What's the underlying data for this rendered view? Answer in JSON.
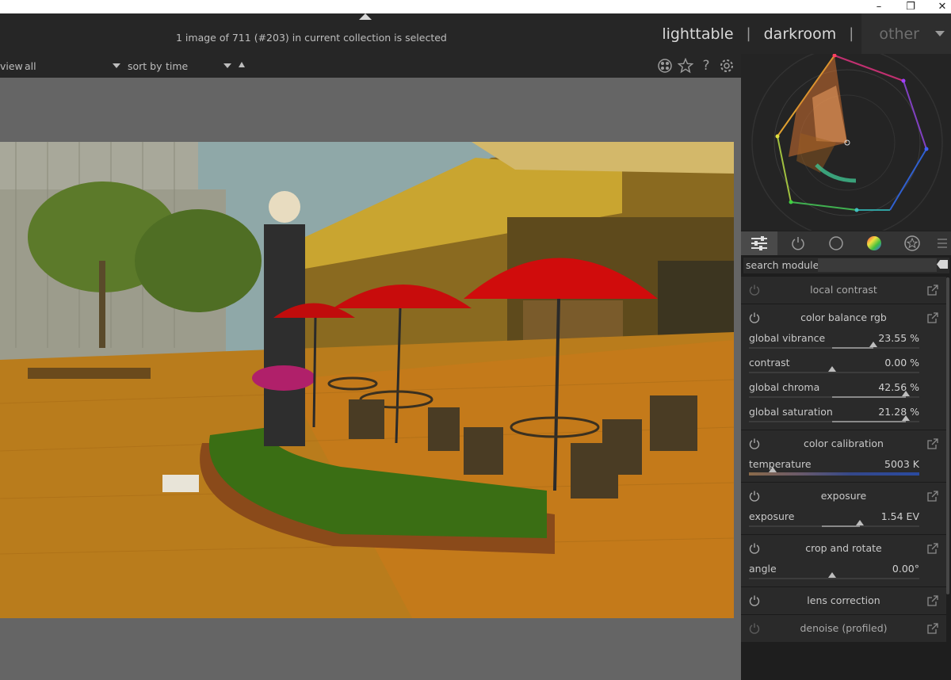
{
  "window": {
    "minimize_icon": "minimize-icon",
    "restore_icon": "restore-icon",
    "close_icon": "close-icon"
  },
  "header": {
    "status": "1 image of 711 (#203) in current collection is selected",
    "views": {
      "lighttable": "lighttable",
      "sep1": "|",
      "darkroom": "darkroom",
      "sep2": "|",
      "other": "other"
    }
  },
  "filterbar": {
    "view_label": "view",
    "view_value": "all",
    "sort_label": "sort by",
    "sort_value": "time",
    "icons": [
      "grouping-icon",
      "star-icon",
      "help-icon",
      "gear-icon"
    ]
  },
  "right_panel": {
    "tabs": [
      "quick-access-icon",
      "active-modules-icon",
      "base-modules-icon",
      "color-modules-icon",
      "effect-modules-icon",
      "presets-menu-icon"
    ],
    "search": {
      "label": "search module",
      "placeholder": ""
    },
    "modules": [
      {
        "name": "local contrast",
        "enabled": false
      },
      {
        "name": "color balance rgb",
        "enabled": true,
        "sliders": [
          {
            "label": "global vibrance",
            "value": "23.55 %",
            "pos": 0.73,
            "fill_from": 0.49
          },
          {
            "label": "contrast",
            "value": "0.00 %",
            "pos": 0.49
          },
          {
            "label": "global chroma",
            "value": "42.56 %",
            "pos": 0.92,
            "fill_from": 0.49
          },
          {
            "label": "global saturation",
            "value": "21.28 %",
            "pos": 0.92,
            "fill_from": 0.49
          }
        ]
      },
      {
        "name": "color calibration",
        "enabled": true,
        "sliders": [
          {
            "label": "temperature",
            "value": "5003 K",
            "pos": 0.14,
            "type": "temp"
          }
        ]
      },
      {
        "name": "exposure",
        "enabled": true,
        "sliders": [
          {
            "label": "exposure",
            "value": "1.54 EV",
            "pos": 0.65,
            "fill_from": 0.43
          }
        ]
      },
      {
        "name": "crop and rotate",
        "enabled": true,
        "sliders": [
          {
            "label": "angle",
            "value": "0.00°",
            "pos": 0.49
          }
        ]
      },
      {
        "name": "lens correction",
        "enabled": true
      },
      {
        "name": "denoise (profiled)",
        "enabled": false
      }
    ]
  }
}
